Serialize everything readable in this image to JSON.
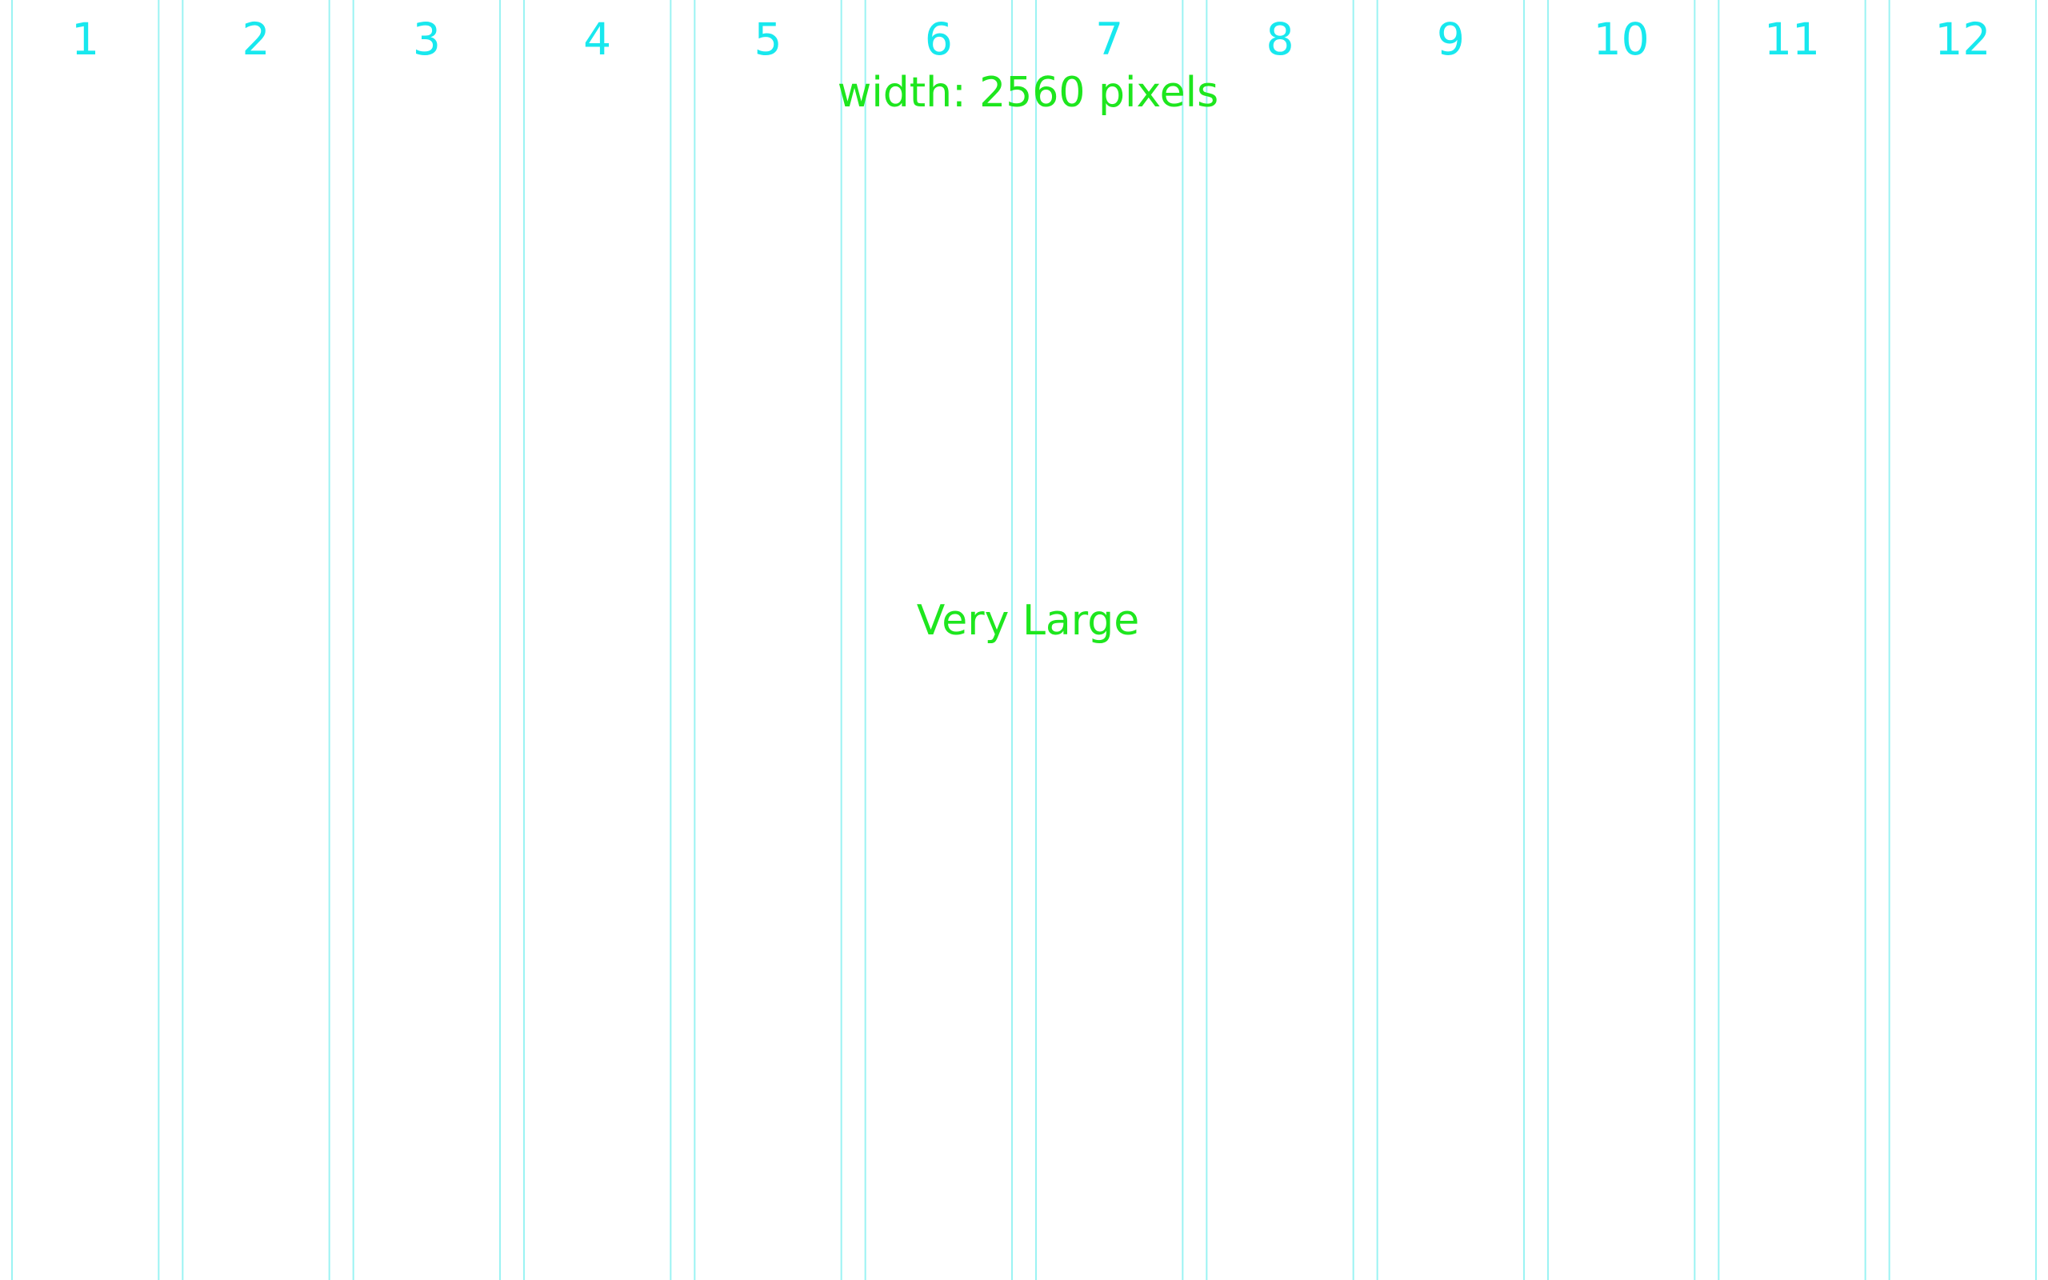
{
  "grid": {
    "columns": [
      "1",
      "2",
      "3",
      "4",
      "5",
      "6",
      "7",
      "8",
      "9",
      "10",
      "11",
      "12"
    ],
    "line_color": "#9bf3f3",
    "number_color": "#18e8ee"
  },
  "labels": {
    "width_text": "width: 2560 pixels",
    "size_text": "Very Large",
    "text_color": "#1ee61e"
  }
}
